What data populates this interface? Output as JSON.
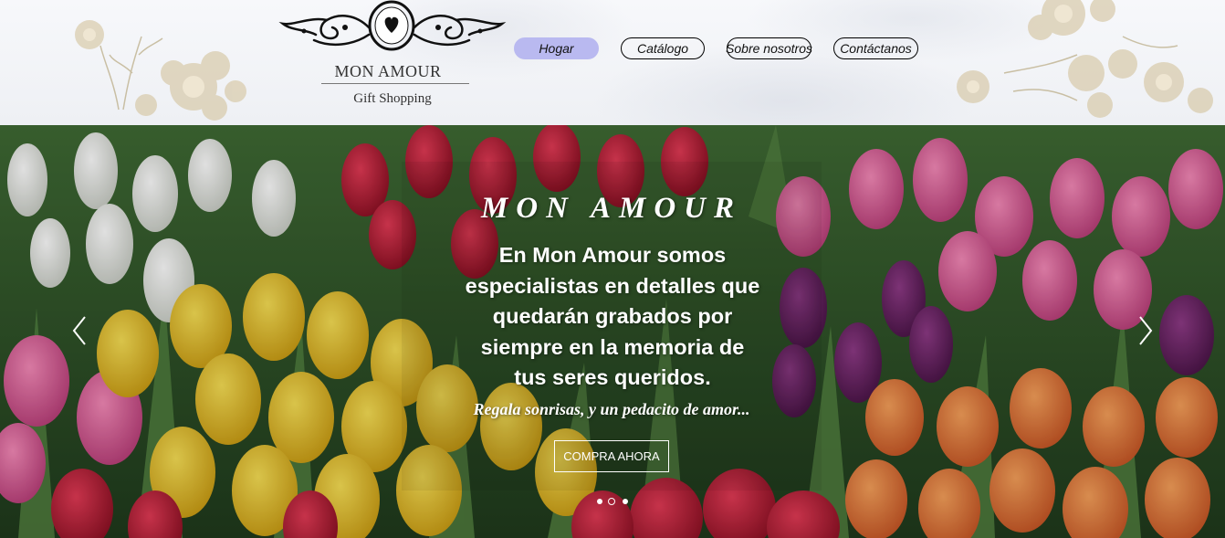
{
  "brand": {
    "name": "MON AMOUR",
    "subtitle": "Gift Shopping"
  },
  "nav": {
    "items": [
      {
        "label": "Hogar",
        "active": true
      },
      {
        "label": "Catálogo",
        "active": false
      },
      {
        "label": "Sobre nosotros",
        "active": false
      },
      {
        "label": "Contáctanos",
        "active": false
      }
    ],
    "active_color": "#b9b9f0"
  },
  "hero": {
    "title": "MON AMOUR",
    "lines": [
      "En Mon Amour somos",
      "especialistas en detalles que",
      "quedarán grabados por",
      "siempre en la memoria de",
      "tus seres queridos."
    ],
    "tagline": "Regala sonrisas, y un pedacito de amor...",
    "cta_label": "COMPRA AHORA",
    "slides_total": 3,
    "active_slide": 2
  },
  "icons": {
    "prev": "chevron-left-icon",
    "next": "chevron-right-icon",
    "logo": "heart-ornament-icon"
  }
}
